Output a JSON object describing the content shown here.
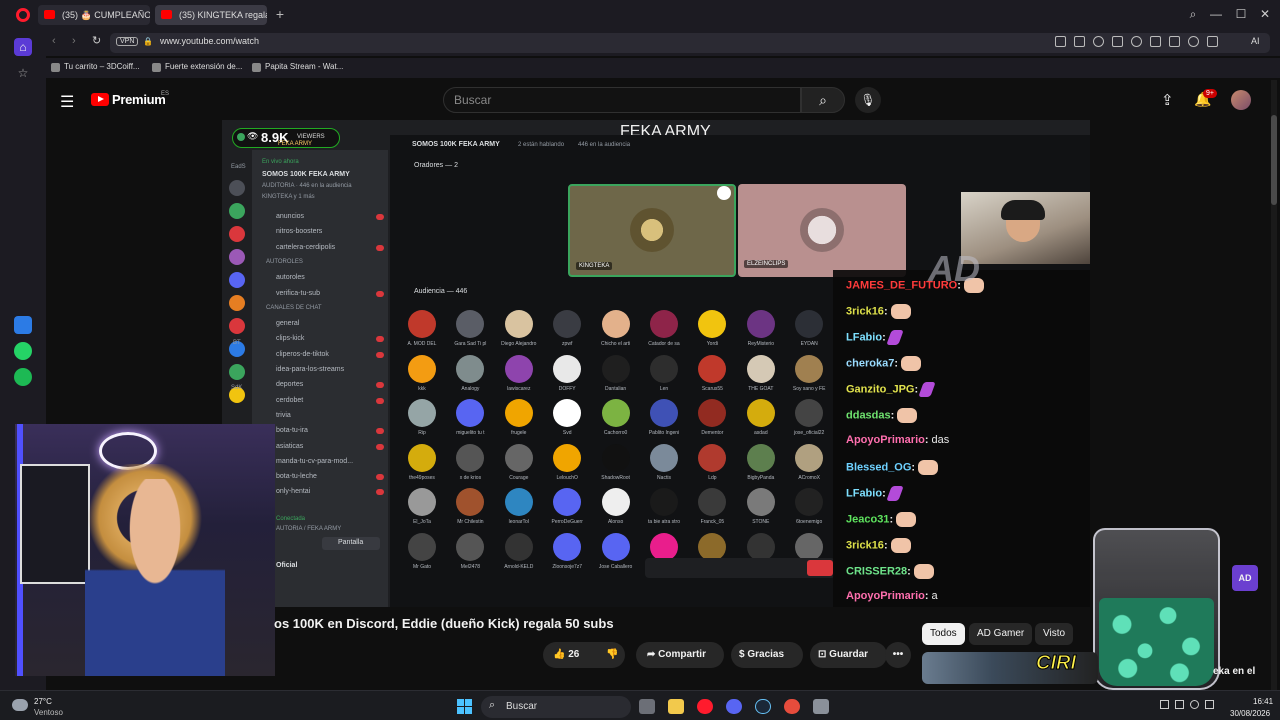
{
  "browser": {
    "tabs": [
      {
        "label": "(35) 🎂 CUMPLEAÑOS FES"
      },
      {
        "label": "(35) KINGTEKA regala"
      }
    ],
    "new_tab": "+",
    "window_controls": {
      "search": "⌕",
      "minimize": "—",
      "maximize": "☐",
      "close": "✕"
    },
    "vpn": "VPN",
    "url": "www.youtube.com/watch",
    "ai_label": "AI",
    "bookmarks": [
      {
        "label": "Tu carrito – 3DCoiff..."
      },
      {
        "label": "Fuerte extensión de..."
      },
      {
        "label": "Papita Stream - Wat..."
      }
    ]
  },
  "youtube": {
    "logo_text": "Premium",
    "region": "ES",
    "search_placeholder": "Buscar",
    "notifications": "9+",
    "video_title": "os 100K en Discord, Eddie (dueño Kick) regala 50 subs",
    "actions": {
      "likes": "26",
      "share": "Compartir",
      "thanks": "Gracias",
      "save": "Guardar",
      "more": "•••"
    },
    "chips": [
      "Todos",
      "AD Gamer",
      "Visto"
    ],
    "thumb_text": "CIRI",
    "side_text": "eka en el"
  },
  "stream": {
    "viewers": "8.9K",
    "viewers_label": "VIEWERS",
    "server_banner": "FEKA ARMY",
    "ad_logo": "AD",
    "discord": {
      "window_title": "FEKA ARMY",
      "live_label": "En vivo ahora",
      "stage_name": "SOMOS 100K FEKA ARMY",
      "stage_meta": "AUDITORIA · 446 en la audiencia",
      "stage_host": "KINGTEKA y 1 más",
      "header_title": "SOMOS 100K FEKA ARMY",
      "header_talking": "2 están hablando",
      "header_audience": "446 en la audiencia",
      "speakers_label": "Oradores — 2",
      "audience_label": "Audiencia — 446",
      "speakers": [
        "KINGTEKA",
        "ELZEINCLIPS"
      ],
      "channels": [
        "anuncios",
        "nitros-boosters",
        "cartelera-cerdipolis",
        "AUTOROLES",
        "autoroles",
        "verifica-tu-sub",
        "CANALES DE CHAT",
        "general",
        "clips-kick",
        "cliperos-de-tiktok",
        "idea-para-los-streams",
        "deportes",
        "cerdobet",
        "trivia",
        "bota-tu-ira",
        "asiaticas",
        "manda-tu-cv-para-mod...",
        "bota-tu-leche",
        "only-hentai"
      ],
      "voice_status": "Conectada",
      "voice_sub": "AUTORIA / FEKA ARMY",
      "screen_button": "Pantalla",
      "user_name": "Oficial",
      "server_labels": [
        "EadS",
        "BT",
        "SdK"
      ],
      "audience": [
        "A. MOD DEL",
        "Gara Sad Ti pl",
        "Diego Alejandro",
        "zpwf",
        "Chicho el arti",
        "Catador de sa",
        "Yordi",
        "ReyMisterio",
        "EYDAN",
        "kkk",
        "Analogy",
        "lawiscarez",
        "DOFFY",
        "Dantalian",
        "Len",
        "Scarus55",
        "THE GOAT",
        "Soy sano y FE",
        "Rip",
        "miguelito tu t",
        "frugele",
        "Svd",
        "Cachorro0",
        "Pablito Ingeni",
        "Dementor",
        "asdad",
        "jose_oficial22",
        "the49poses",
        "x de krios",
        "Courage",
        "LelouchO",
        "ShadowRoot",
        "Nactis",
        "Ldp",
        "BigbyPanda",
        "ACromoX",
        "El_JoTa",
        "Mr Chilestin",
        "leonarTol",
        "PerroDeGuerr",
        "Alonso",
        "ta bie atra stro",
        "Franck_05",
        "STONE",
        "6toenemigo",
        "Mr Gato",
        "Mel2478",
        "Arnold-KELD",
        "Zloonsoje7z7",
        "Jose Caballero",
        "",
        "",
        "",
        ""
      ]
    },
    "chat": [
      {
        "user": "JAMES_DE_FUTURO",
        "color": "#ff3b3b",
        "msg": "",
        "emote": "face"
      },
      {
        "user": "3rick16",
        "color": "#dde04a",
        "msg": "",
        "emote": "face"
      },
      {
        "user": "LFabio",
        "color": "#7ee0ff",
        "msg": "",
        "emote": "purple"
      },
      {
        "user": "cheroka7",
        "color": "#9adcff",
        "msg": "",
        "emote": "face"
      },
      {
        "user": "Ganzito_JPG",
        "color": "#e2e34d",
        "msg": "",
        "emote": "purple"
      },
      {
        "user": "ddasdas",
        "color": "#6fe36f",
        "msg": "",
        "emote": "face"
      },
      {
        "user": "ApoyoPrimario",
        "color": "#ff6fae",
        "msg": "das",
        "emote": ""
      },
      {
        "user": "Blessed_OG",
        "color": "#6ed1ff",
        "msg": "",
        "emote": "face"
      },
      {
        "user": "LFabio",
        "color": "#7ee0ff",
        "msg": "",
        "emote": "purple"
      },
      {
        "user": "Jeaco31",
        "color": "#5ee35e",
        "msg": "",
        "emote": "face"
      },
      {
        "user": "3rick16",
        "color": "#dde04a",
        "msg": "",
        "emote": "face"
      },
      {
        "user": "CRISSER28",
        "color": "#6ee38a",
        "msg": "",
        "emote": "face"
      },
      {
        "user": "ApoyoPrimario",
        "color": "#ff6fae",
        "msg": "a",
        "emote": ""
      }
    ]
  },
  "taskbar": {
    "temperature": "27°C",
    "weather": "Ventoso",
    "search": "Buscar",
    "time": "16:41",
    "date": "30/08/2026"
  }
}
